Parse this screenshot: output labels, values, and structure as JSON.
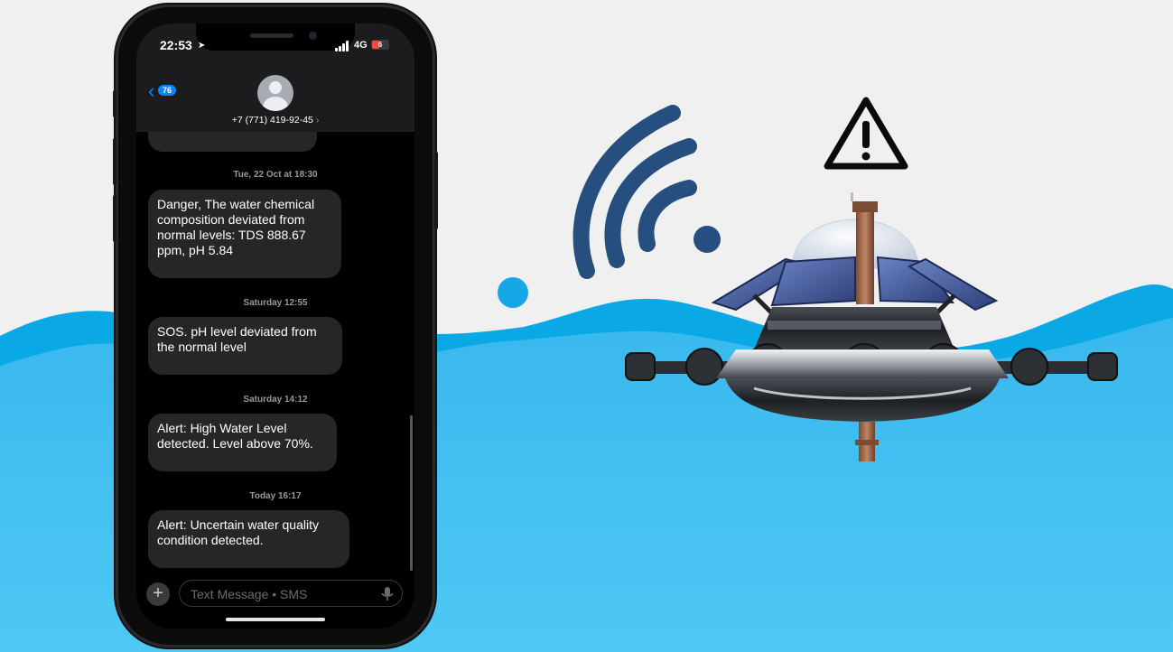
{
  "phone": {
    "status_bar": {
      "time": "22:53",
      "network": "4G",
      "battery": "6",
      "location_icon": "location-arrow-icon",
      "signal_icon": "cellular-signal-icon"
    },
    "header": {
      "back_count": "76",
      "back_icon": "chevron-left-icon",
      "contact_number": "+7 (771) 419-92-45",
      "contact_chevron": "›",
      "avatar_icon": "person-avatar-icon"
    },
    "messages": [
      {
        "timestamp": "Tue, 22 Oct at 18:30",
        "lines": [
          "Danger, The water chemical",
          "composition deviated from",
          "normal levels: TDS 888.67",
          "ppm, pH 5.84"
        ]
      },
      {
        "timestamp": "Saturday 12:55",
        "lines": [
          "SOS. pH level deviated from",
          "the normal level"
        ]
      },
      {
        "timestamp": "Saturday 14:12",
        "lines": [
          "Alert: High Water Level",
          "detected. Level above 70%."
        ]
      },
      {
        "timestamp": "Today 16:17",
        "lines": [
          "Alert: Uncertain water quality",
          "condition detected."
        ]
      }
    ],
    "composer": {
      "placeholder": "Text Message • SMS",
      "plus_label": "+",
      "mic_icon": "microphone-icon"
    }
  },
  "illustration": {
    "wifi_icon": "wifi-signal-icon",
    "warning_icon": "warning-triangle-icon",
    "device": "water-monitoring-buoy",
    "colors": {
      "water": "#4fc3f0",
      "wave": "#0aa9e6",
      "wifi": "#264f7f",
      "background": "#f0f0f1"
    }
  }
}
